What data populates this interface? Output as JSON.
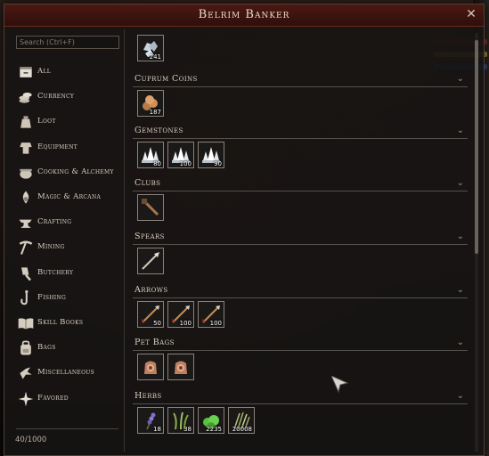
{
  "window": {
    "title": "Belrim Banker",
    "close_glyph": "✕"
  },
  "search": {
    "placeholder": "Search (Ctrl+F)"
  },
  "sidebar": {
    "items": [
      {
        "label": "All",
        "icon": "all-icon"
      },
      {
        "label": "Currency",
        "icon": "coins-icon"
      },
      {
        "label": "Loot",
        "icon": "loot-bag-icon"
      },
      {
        "label": "Equipment",
        "icon": "armor-icon"
      },
      {
        "label": "Cooking & Alchemy",
        "icon": "cauldron-icon"
      },
      {
        "label": "Magic & Arcana",
        "icon": "magic-icon"
      },
      {
        "label": "Crafting",
        "icon": "anvil-icon"
      },
      {
        "label": "Mining",
        "icon": "pickaxe-icon"
      },
      {
        "label": "Butchery",
        "icon": "cleaver-icon"
      },
      {
        "label": "Fishing",
        "icon": "fishhook-icon"
      },
      {
        "label": "Skill Books",
        "icon": "book-icon"
      },
      {
        "label": "Bags",
        "icon": "backpack-icon"
      },
      {
        "label": "Miscellaneous",
        "icon": "misc-icon"
      },
      {
        "label": "Favored",
        "icon": "star-icon"
      }
    ],
    "capacity": "40/1000"
  },
  "top_item": {
    "icon": "silver-ore-icon",
    "qty": "241"
  },
  "sections": [
    {
      "title": "Cuprum Coins",
      "items": [
        {
          "icon": "copper-coins-icon",
          "qty": "187"
        }
      ]
    },
    {
      "title": "Gemstones",
      "items": [
        {
          "icon": "crystal-cluster-icon",
          "qty": "80"
        },
        {
          "icon": "crystal-cluster-icon",
          "qty": "100"
        },
        {
          "icon": "crystal-cluster-icon",
          "qty": "90"
        }
      ]
    },
    {
      "title": "Clubs",
      "items": [
        {
          "icon": "club-icon",
          "qty": ""
        }
      ]
    },
    {
      "title": "Spears",
      "items": [
        {
          "icon": "spear-icon",
          "qty": ""
        }
      ]
    },
    {
      "title": "Arrows",
      "items": [
        {
          "icon": "arrow-icon",
          "qty": "50"
        },
        {
          "icon": "arrow-icon",
          "qty": "100"
        },
        {
          "icon": "arrow-icon",
          "qty": "100"
        }
      ]
    },
    {
      "title": "Pet Bags",
      "items": [
        {
          "icon": "pet-bag-icon",
          "qty": ""
        },
        {
          "icon": "pet-bag-icon",
          "qty": ""
        }
      ]
    },
    {
      "title": "Herbs",
      "items": [
        {
          "icon": "lavender-herb-icon",
          "qty": "18"
        },
        {
          "icon": "grass-herb-icon",
          "qty": "38"
        },
        {
          "icon": "green-moss-icon",
          "qty": "2235"
        },
        {
          "icon": "fiber-herb-icon",
          "qty": "20008"
        }
      ]
    }
  ],
  "colors": {
    "accent": "#5a1a13",
    "text": "#d8cfc0",
    "border": "#8a8278"
  }
}
